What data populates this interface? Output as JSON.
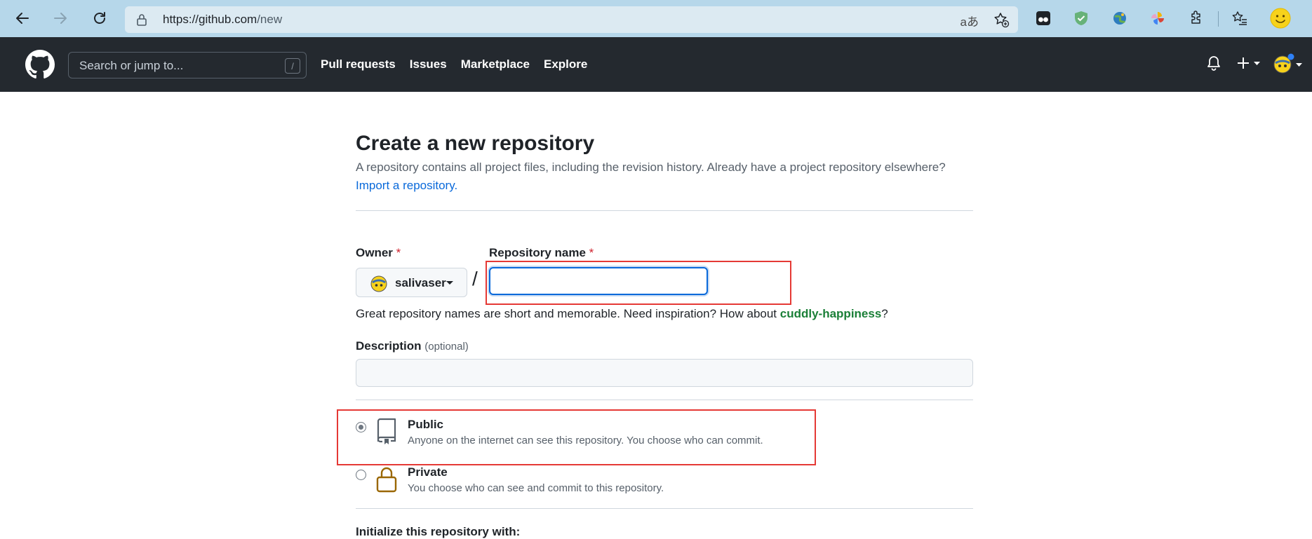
{
  "browser": {
    "url_host": "https://github.com",
    "url_path": "/new",
    "read_aloud_label": "aあ"
  },
  "github_header": {
    "search_placeholder": "Search or jump to...",
    "search_shortcut": "/",
    "nav": [
      "Pull requests",
      "Issues",
      "Marketplace",
      "Explore"
    ]
  },
  "page": {
    "title": "Create a new repository",
    "subtitle": "A repository contains all project files, including the revision history. Already have a project repository elsewhere?",
    "import_link": "Import a repository."
  },
  "form": {
    "owner_label": "Owner",
    "owner_value": "salivaser",
    "required_mark": "*",
    "separator": "/",
    "repo_name_label": "Repository name",
    "repo_name_value": "",
    "hint_prefix": "Great repository names are short and memorable. Need inspiration? How about ",
    "hint_suggestion": "cuddly-happiness",
    "hint_suffix": "?",
    "description_label": "Description",
    "description_optional": "(optional)",
    "description_value": "",
    "visibility": [
      {
        "title": "Public",
        "desc": "Anyone on the internet can see this repository. You choose who can commit.",
        "checked": true
      },
      {
        "title": "Private",
        "desc": "You choose who can see and commit to this repository.",
        "checked": false
      }
    ],
    "cut_off_section": "Initialize this repository with:"
  },
  "colors": {
    "header_bg": "#24292f",
    "browser_bar": "#b6d7ea",
    "link_blue": "#0969da",
    "suggestion_green": "#1a7f37",
    "highlight_red": "#e53935"
  }
}
